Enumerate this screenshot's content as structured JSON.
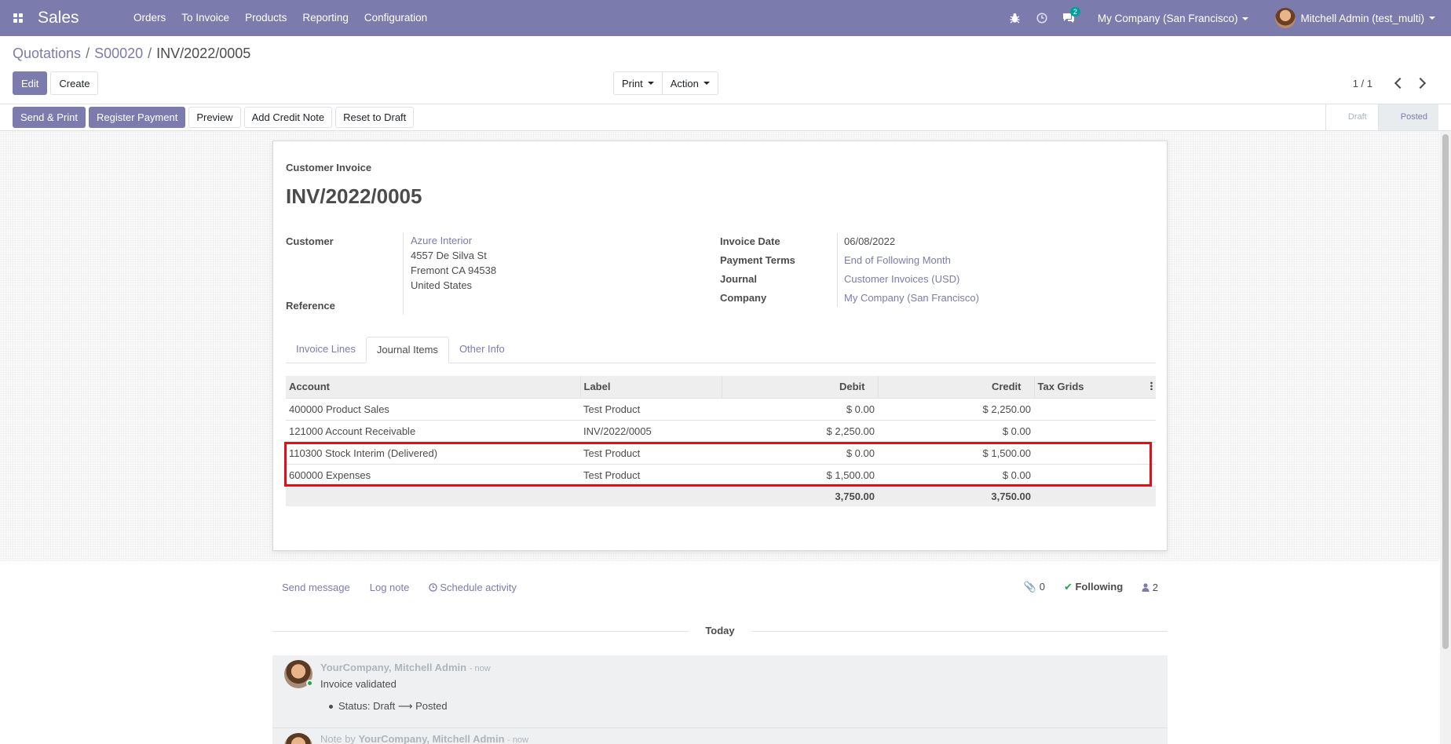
{
  "navbar": {
    "brand": "Sales",
    "menu": [
      "Orders",
      "To Invoice",
      "Products",
      "Reporting",
      "Configuration"
    ],
    "messages_badge": "2",
    "company": "My Company (San Francisco)",
    "user": "Mitchell Admin (test_multi)"
  },
  "breadcrumb": {
    "level1": "Quotations",
    "level2": "S00020",
    "current": "INV/2022/0005"
  },
  "buttons": {
    "edit": "Edit",
    "create": "Create",
    "print": "Print",
    "action": "Action"
  },
  "pager": {
    "value": "1 / 1"
  },
  "statusbar": {
    "send_print": "Send & Print",
    "register_payment": "Register Payment",
    "preview": "Preview",
    "add_credit_note": "Add Credit Note",
    "reset_to_draft": "Reset to Draft",
    "stage_draft": "Draft",
    "stage_posted": "Posted"
  },
  "invoice": {
    "type": "Customer Invoice",
    "number": "INV/2022/0005",
    "customer_label": "Customer",
    "customer_name": "Azure Interior",
    "address1": "4557 De Silva St",
    "address2": "Fremont CA 94538",
    "address3": "United States",
    "reference_label": "Reference",
    "invoice_date_label": "Invoice Date",
    "invoice_date": "06/08/2022",
    "payment_terms_label": "Payment Terms",
    "payment_terms": "End of Following Month",
    "journal_label": "Journal",
    "journal": "Customer Invoices (USD)",
    "company_label": "Company",
    "company": "My Company (San Francisco)"
  },
  "tabs": [
    "Invoice Lines",
    "Journal Items",
    "Other Info"
  ],
  "journal_table": {
    "headers": [
      "Account",
      "Label",
      "Debit",
      "Credit",
      "Tax Grids"
    ],
    "rows": [
      [
        "400000 Product Sales",
        "Test Product",
        "$ 0.00",
        "$ 2,250.00",
        ""
      ],
      [
        "121000 Account Receivable",
        "INV/2022/0005",
        "$ 2,250.00",
        "$ 0.00",
        ""
      ],
      [
        "110300 Stock Interim (Delivered)",
        "Test Product",
        "$ 0.00",
        "$ 1,500.00",
        ""
      ],
      [
        "600000 Expenses",
        "Test Product",
        "$ 1,500.00",
        "$ 0.00",
        ""
      ]
    ],
    "total_debit": "3,750.00",
    "total_credit": "3,750.00"
  },
  "chatter": {
    "send_message": "Send message",
    "log_note": "Log note",
    "schedule_activity": "Schedule activity",
    "attachments_count": "0",
    "following": "Following",
    "followers_count": "2",
    "today": "Today",
    "message1": {
      "author": "YourCompany, Mitchell Admin",
      "time": "now",
      "body": "Invoice validated",
      "tracking": "Status: Draft ⟶ Posted"
    },
    "message2": {
      "prefix": "Note by",
      "author": "YourCompany, Mitchell Admin",
      "time": "now"
    }
  },
  "colors": {
    "brand": "#7c7bad",
    "highlight": "#e0101a"
  },
  "icons": [
    "apps-icon",
    "bug-icon",
    "clock-icon",
    "chat-icon",
    "paperclip-icon",
    "check-icon",
    "user-icon"
  ]
}
